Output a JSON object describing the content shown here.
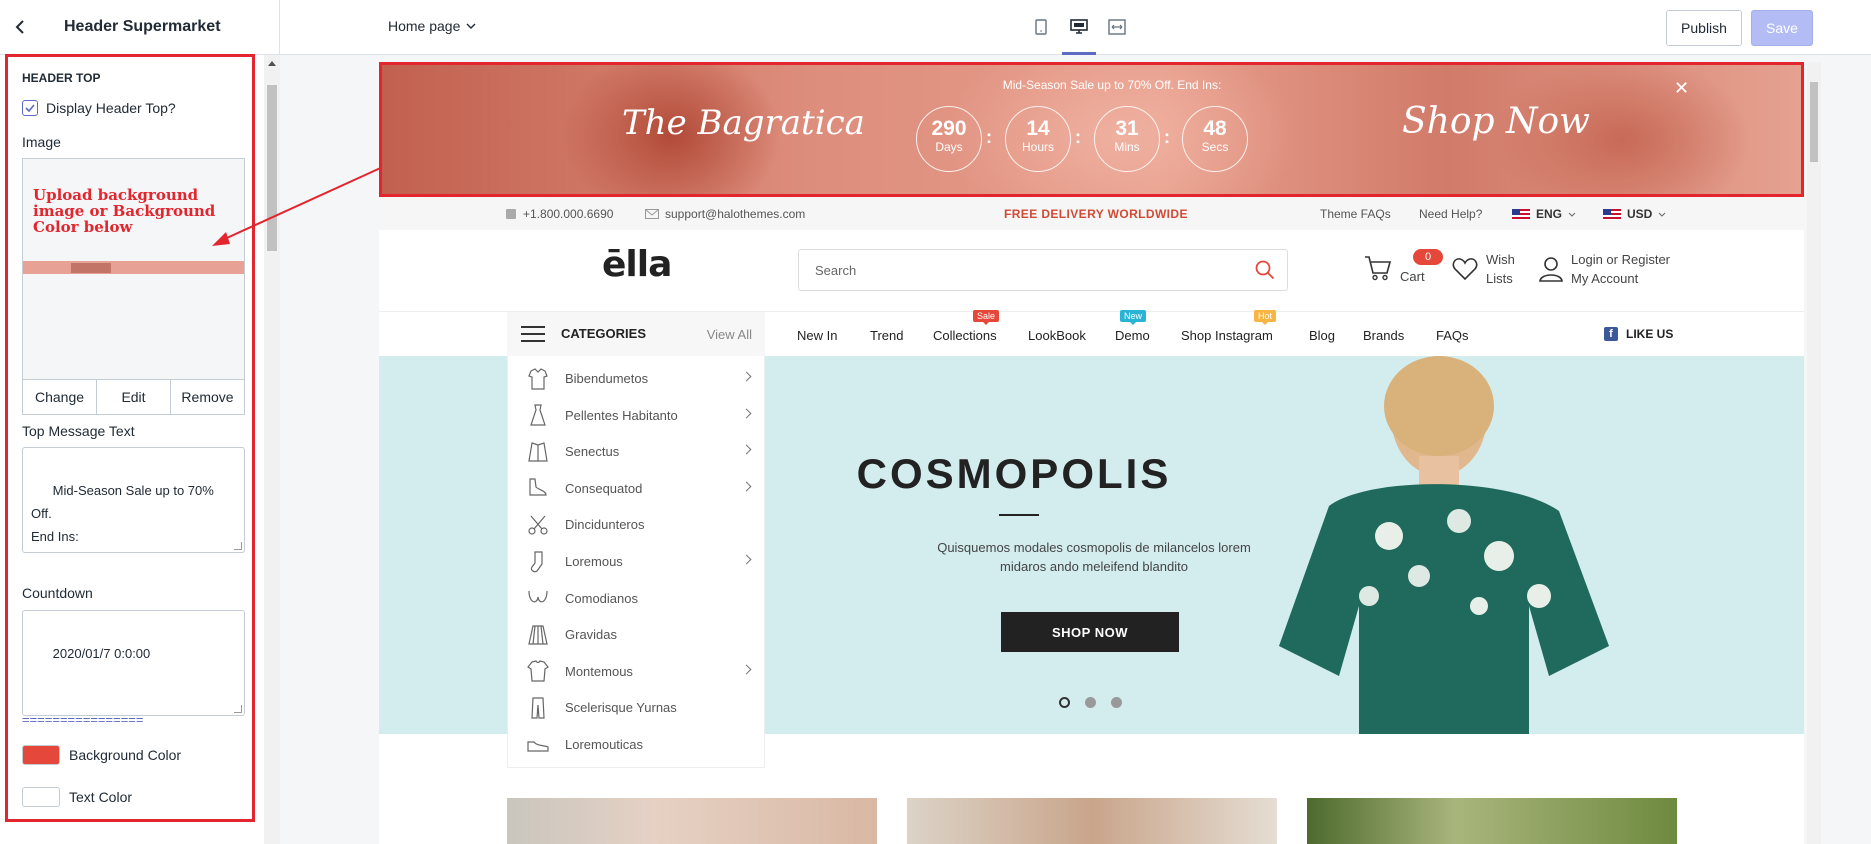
{
  "sidebar": {
    "title": "Header Supermarket",
    "section_title": "HEADER TOP",
    "display_checkbox_label": "Display Header Top?",
    "image_label": "Image",
    "image_note": "Upload background image or Background Color below",
    "image_buttons": [
      "Change",
      "Edit",
      "Remove"
    ],
    "top_message_label": "Top Message Text",
    "top_message_value": "Mid-Season Sale up to 70% Off.\nEnd Ins:",
    "countdown_label": "Countdown",
    "countdown_value": "2020/01/7 0:0:00",
    "separator": "================",
    "background_color_label": "Background Color",
    "background_color": "#e5473a",
    "text_color_label": "Text Color",
    "text_color": "#ffffff"
  },
  "topbar": {
    "page_select": "Home page",
    "publish_label": "Publish",
    "save_label": "Save"
  },
  "banner": {
    "message": "Mid-Season Sale up to 70% Off. End Ins:",
    "left_script": "The Bagratica",
    "right_script": "Shop Now",
    "countdown": [
      {
        "value": "290",
        "unit": "Days"
      },
      {
        "value": "14",
        "unit": "Hours"
      },
      {
        "value": "31",
        "unit": "Mins"
      },
      {
        "value": "48",
        "unit": "Secs"
      }
    ]
  },
  "infobar": {
    "phone": "+1.800.000.6690",
    "email": "support@halothemes.com",
    "promo": "FREE DELIVERY WORLDWIDE",
    "faqs": "Theme FAQs",
    "help": "Need Help?",
    "language": "ENG",
    "currency": "USD"
  },
  "header": {
    "logo": "ēlla",
    "search_placeholder": "Search",
    "cart_count": "0",
    "cart_label": "Cart",
    "wish_line1": "Wish",
    "wish_line2": "Lists",
    "login_line1": "Login or Register",
    "login_line2": "My Account"
  },
  "nav": {
    "categories_label": "CATEGORIES",
    "view_all": "View All",
    "links": [
      {
        "label": "New In"
      },
      {
        "label": "Trend"
      },
      {
        "label": "Collections",
        "tag": "Sale"
      },
      {
        "label": "LookBook"
      },
      {
        "label": "Demo",
        "tag": "New"
      },
      {
        "label": "Shop Instagram",
        "tag": "Hot"
      },
      {
        "label": "Blog"
      },
      {
        "label": "Brands"
      },
      {
        "label": "FAQs"
      }
    ],
    "like_us": "LIKE US"
  },
  "categories": [
    {
      "label": "Bibendumetos",
      "icon": "shirt-icon",
      "has_sub": true
    },
    {
      "label": "Pellentes Habitanto",
      "icon": "dress-icon",
      "has_sub": true
    },
    {
      "label": "Senectus",
      "icon": "jacket-icon",
      "has_sub": true
    },
    {
      "label": "Consequatod",
      "icon": "heel-icon",
      "has_sub": true
    },
    {
      "label": "Dincidunteros",
      "icon": "scissors-icon",
      "has_sub": false
    },
    {
      "label": "Loremous",
      "icon": "sock-icon",
      "has_sub": true
    },
    {
      "label": "Comodianos",
      "icon": "bra-icon",
      "has_sub": false
    },
    {
      "label": "Gravidas",
      "icon": "skirt-icon",
      "has_sub": false
    },
    {
      "label": "Montemous",
      "icon": "tshirt-icon",
      "has_sub": true
    },
    {
      "label": "Scelerisque Yurnas",
      "icon": "pants-icon",
      "has_sub": false
    },
    {
      "label": "Loremouticas",
      "icon": "shoe-icon",
      "has_sub": false
    }
  ],
  "hero": {
    "title": "COSMOPOLIS",
    "subtitle": "Quisquemos modales cosmopolis de milancelos lorem midaros ando meleifend blandito",
    "button": "SHOP NOW",
    "slides_total": 3,
    "slide_active": 1
  },
  "colors": {
    "accent": "#5c6ac4",
    "highlight": "#e3252e",
    "sale_tag": "#e5473a",
    "new_tag": "#29b4d6",
    "hot_tag": "#f7b543"
  }
}
